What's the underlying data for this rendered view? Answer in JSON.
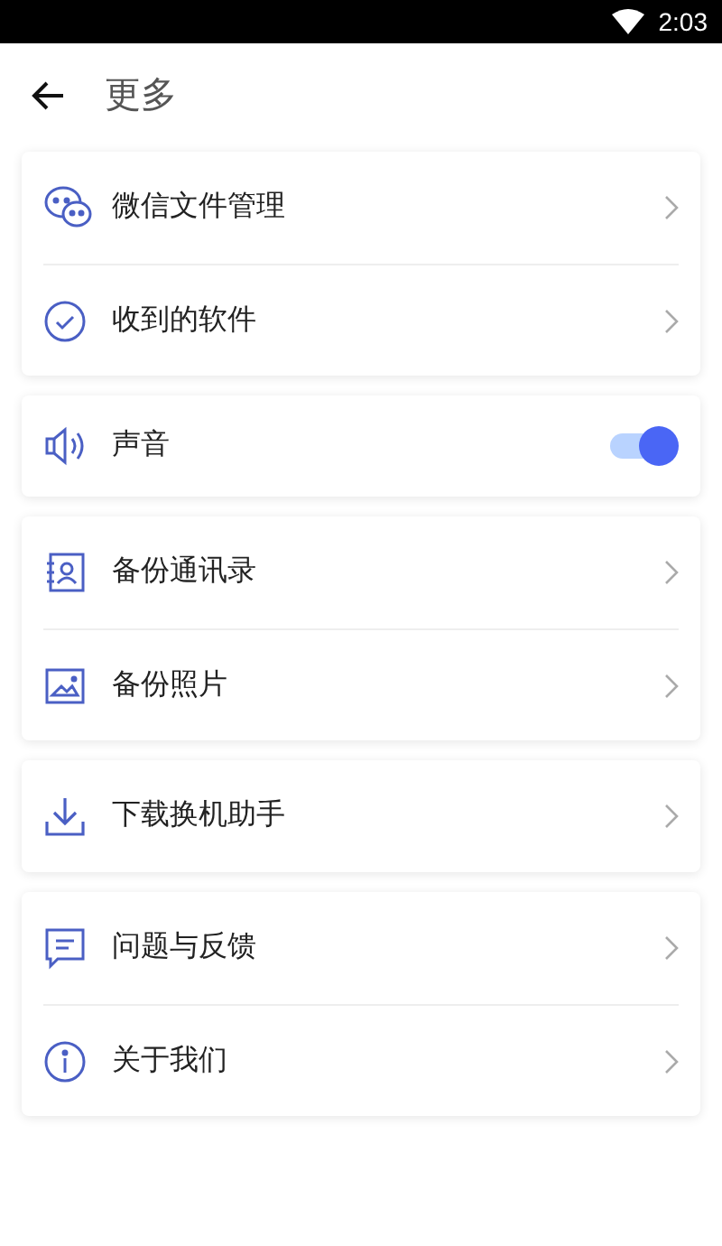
{
  "status_bar": {
    "time": "2:03"
  },
  "header": {
    "title": "更多"
  },
  "groups": [
    {
      "items": [
        {
          "kind": "link",
          "label": "微信文件管理"
        },
        {
          "kind": "link",
          "label": "收到的软件"
        }
      ]
    },
    {
      "items": [
        {
          "kind": "toggle",
          "label": "声音",
          "on": true
        }
      ]
    },
    {
      "items": [
        {
          "kind": "link",
          "label": "备份通讯录"
        },
        {
          "kind": "link",
          "label": "备份照片"
        }
      ]
    },
    {
      "items": [
        {
          "kind": "link",
          "label": "下载换机助手"
        }
      ]
    },
    {
      "items": [
        {
          "kind": "link",
          "label": "问题与反馈"
        },
        {
          "kind": "link",
          "label": "关于我们"
        }
      ]
    }
  ]
}
